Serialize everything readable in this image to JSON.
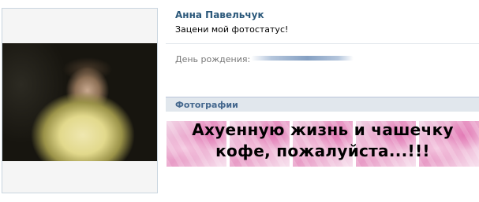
{
  "profile": {
    "name": "Анна Павельчук",
    "status": "Зацени мой фотостатус!",
    "birthday_label": "День рождения:",
    "birthday_value": ""
  },
  "photos": {
    "title": "Фотографии",
    "caption": "Ахуенную жизнь и чашечку кофе, пожалуйста...!!!",
    "thumb_count": 5
  },
  "colors": {
    "name": "#2b587a",
    "section_header_bg": "#e1e7ed",
    "section_title": "#45688e",
    "label": "#777777"
  }
}
